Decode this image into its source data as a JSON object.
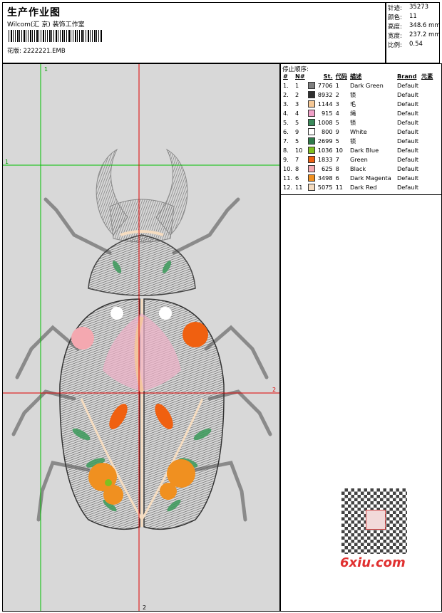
{
  "header": {
    "title": "生产作业图",
    "company": "Wilcom(汇 京) 装饰工作室",
    "design_label": "花版:",
    "design_file": "2222221.EMB"
  },
  "stats": [
    {
      "label": "针迹:",
      "value": "35273"
    },
    {
      "label": "颜色:",
      "value": "11"
    },
    {
      "label": "高度:",
      "value": "348.6 mm"
    },
    {
      "label": "宽度:",
      "value": "237.2 mm"
    },
    {
      "label": "比例:",
      "value": "0.54"
    }
  ],
  "canvas": {
    "guide_mark_top": "1",
    "guide_mark_left": "1",
    "guide_mark_right": "2",
    "guide_mark_bottom": "2"
  },
  "colors": {
    "canvas_bg": "#d8d8d8",
    "guide_red": "#e00000",
    "guide_green": "#00c000"
  },
  "sequence": {
    "title": "停止顺序:",
    "headers": [
      "#",
      "N#",
      "St.",
      "代码",
      "描述",
      "Brand",
      "元素"
    ],
    "rows": [
      {
        "idx": "1.",
        "n": "1",
        "color": "#808080",
        "st": "7706",
        "code": "1",
        "desc": "Dark Green",
        "brand": "Default"
      },
      {
        "idx": "2.",
        "n": "2",
        "color": "#303030",
        "st": "8932",
        "code": "2",
        "desc": "锁",
        "brand": "Default"
      },
      {
        "idx": "3.",
        "n": "3",
        "color": "#f5c896",
        "st": "1144",
        "code": "3",
        "desc": "毛",
        "brand": "Default"
      },
      {
        "idx": "4.",
        "n": "4",
        "color": "#f0a0c8",
        "st": "915",
        "code": "4",
        "desc": "绳",
        "brand": "Default"
      },
      {
        "idx": "5.",
        "n": "5",
        "color": "#3a8a5a",
        "st": "1008",
        "code": "5",
        "desc": "锁",
        "brand": "Default"
      },
      {
        "idx": "6.",
        "n": "9",
        "color": "#ffffff",
        "st": "800",
        "code": "9",
        "desc": "White",
        "brand": "Default"
      },
      {
        "idx": "7.",
        "n": "5",
        "color": "#2f7a4a",
        "st": "2699",
        "code": "5",
        "desc": "锁",
        "brand": "Default"
      },
      {
        "idx": "8.",
        "n": "10",
        "color": "#80c020",
        "st": "1036",
        "code": "10",
        "desc": "Dark Blue",
        "brand": "Default"
      },
      {
        "idx": "9.",
        "n": "7",
        "color": "#f06010",
        "st": "1833",
        "code": "7",
        "desc": "Green",
        "brand": "Default"
      },
      {
        "idx": "10.",
        "n": "8",
        "color": "#f4a8b0",
        "st": "625",
        "code": "8",
        "desc": "Black",
        "brand": "Default"
      },
      {
        "idx": "11.",
        "n": "6",
        "color": "#f09020",
        "st": "3498",
        "code": "6",
        "desc": "Dark Magenta",
        "brand": "Default"
      },
      {
        "idx": "12.",
        "n": "11",
        "color": "#f5dcc0",
        "st": "5075",
        "code": "11",
        "desc": "Dark Red",
        "brand": "Default"
      }
    ]
  },
  "watermark": {
    "text": "6xiu.com"
  }
}
